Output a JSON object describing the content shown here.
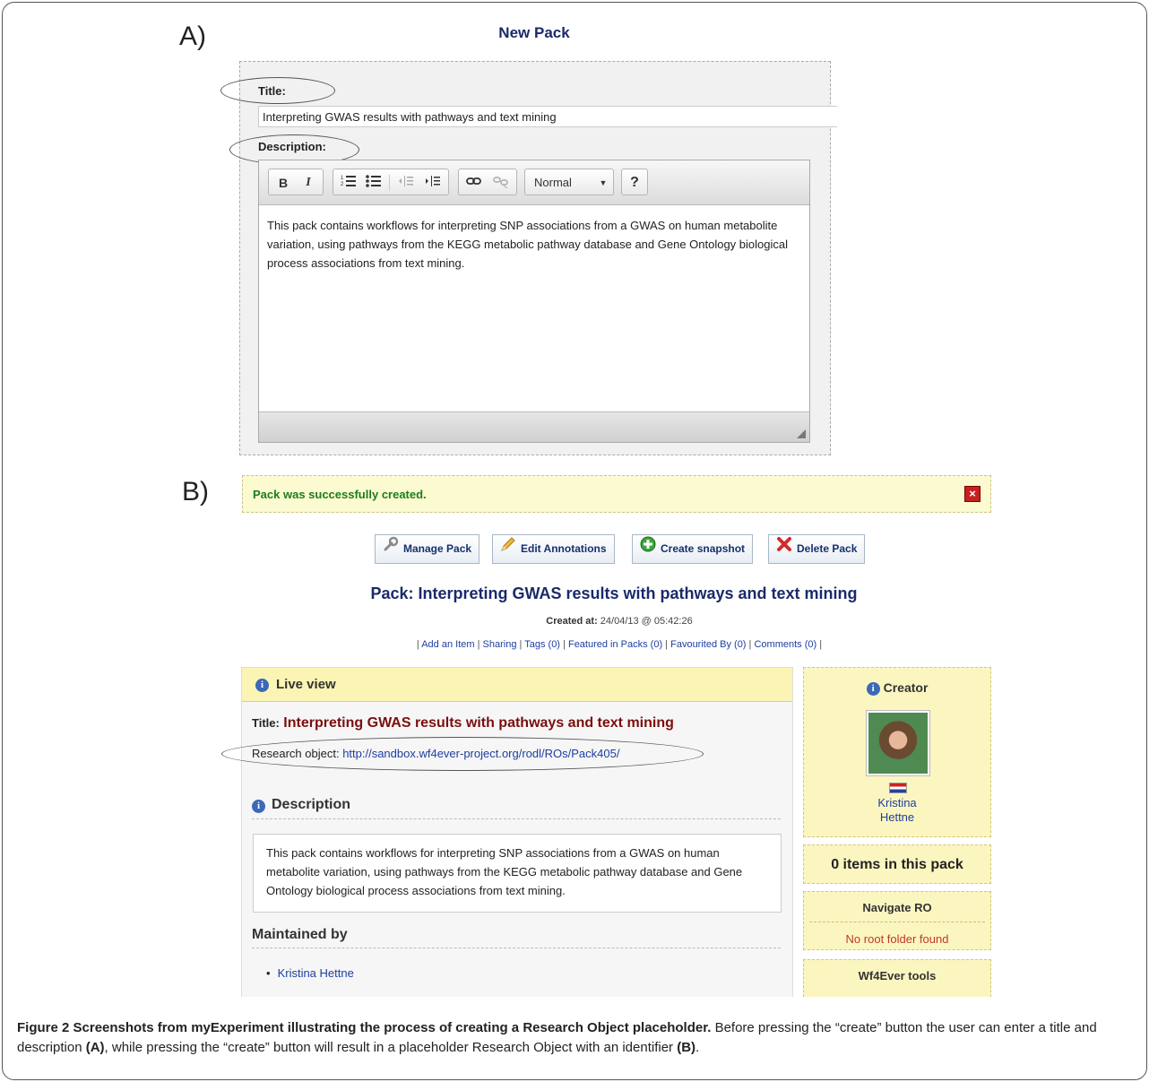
{
  "panel_a": {
    "letter": "A)",
    "header": "New Pack",
    "title_label": "Title:",
    "title_value": "Interpreting GWAS results with pathways and text mining",
    "description_label": "Description:",
    "toolbar": {
      "bold": "B",
      "italic": "I",
      "numbered_list_icon": "numbered-list-icon",
      "bullet_list_icon": "bullet-list-icon",
      "outdent_icon": "outdent-icon",
      "indent_icon": "indent-icon",
      "link_icon": "link-icon",
      "unlink_icon": "unlink-icon",
      "format_select": "Normal",
      "help": "?"
    },
    "description_text": "This pack contains workflows for interpreting SNP associations from a GWAS on human metabolite variation, using pathways from the KEGG metabolic pathway database and Gene Ontology biological process associations from text mining."
  },
  "panel_b": {
    "letter": "B)",
    "success_message": "Pack was successfully created.",
    "close_symbol": "×",
    "actions": {
      "manage": "Manage Pack",
      "edit": "Edit Annotations",
      "snapshot": "Create snapshot",
      "delete": "Delete Pack"
    },
    "pack_heading": "Pack: Interpreting GWAS results with pathways and text mining",
    "created_label": "Created at:",
    "created_value": "24/04/13 @ 05:42:26",
    "links": {
      "add_item": "Add an Item",
      "sharing": "Sharing",
      "tags": "Tags (0)",
      "featured": "Featured in Packs (0)",
      "favourited": "Favourited By (0)",
      "comments": "Comments (0)"
    },
    "live_view_title": "Live view",
    "title_label": "Title:",
    "title_value": "Interpreting GWAS results with pathways and text mining",
    "research_object_label": "Research object:",
    "research_object_url": "http://sandbox.wf4ever-project.org/rodl/ROs/Pack405/",
    "description_heading": "Description",
    "description_text": "This pack contains workflows for interpreting SNP associations from a GWAS on human metabolite variation, using pathways from the KEGG metabolic pathway database and Gene Ontology biological process associations from text mining.",
    "maintained_heading": "Maintained by",
    "maintainer": "Kristina Hettne",
    "sidebar": {
      "creator_title": "Creator",
      "creator_first": "Kristina",
      "creator_last": "Hettne",
      "items_count": "0 items in this pack",
      "navigate_title": "Navigate RO",
      "navigate_message": "No root folder found",
      "tools_title": "Wf4Ever tools"
    }
  },
  "caption": {
    "bold_lead": "Figure 2 Screenshots from myExperiment illustrating the process of creating a Research Object placeholder.",
    "text1": " Before pressing the “create” button the user can enter a title and description ",
    "ref_a": "(A)",
    "text2": ", while pressing the “create” button will result in a placeholder Research Object with an identifier ",
    "ref_b": "(B)",
    "text3": "."
  },
  "colors": {
    "success_green": "#1d7d1d",
    "link_blue": "#1e3ea0",
    "title_red": "#7a0e0e",
    "panel_yellow": "#fbf4b4"
  }
}
